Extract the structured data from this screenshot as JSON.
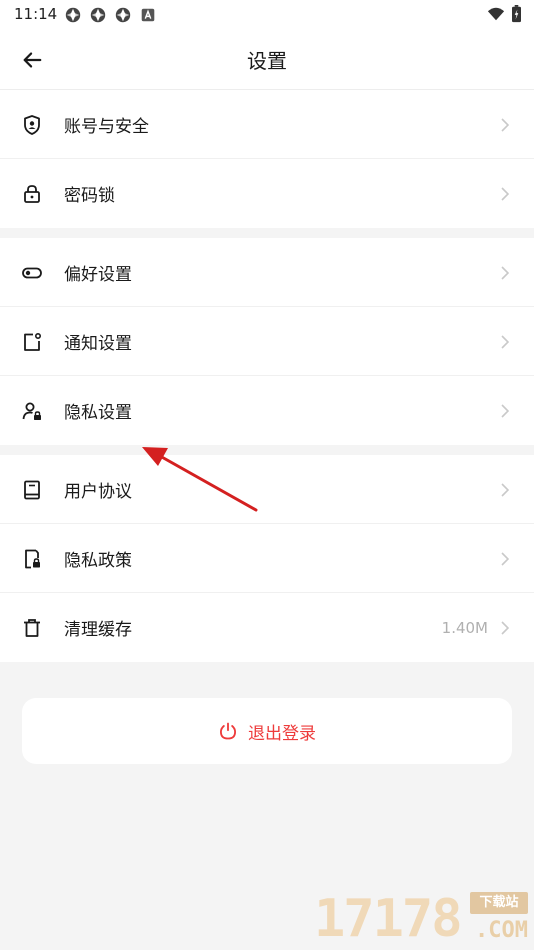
{
  "status_bar": {
    "time": "11:14",
    "notification_icons": [
      "app-notification-icon",
      "app-notification-icon",
      "app-notification-icon",
      "a-badge-icon"
    ],
    "right_icons": [
      "wifi-icon",
      "battery-icon"
    ]
  },
  "header": {
    "title": "设置",
    "back_icon": "arrow-left-icon"
  },
  "groups": [
    {
      "items": [
        {
          "label": "账号与安全",
          "icon": "shield-user-icon",
          "value": ""
        },
        {
          "label": "密码锁",
          "icon": "lock-icon",
          "value": ""
        }
      ]
    },
    {
      "items": [
        {
          "label": "偏好设置",
          "icon": "toggle-icon",
          "value": ""
        },
        {
          "label": "通知设置",
          "icon": "notification-icon",
          "value": ""
        },
        {
          "label": "隐私设置",
          "icon": "user-lock-icon",
          "value": ""
        }
      ]
    },
    {
      "items": [
        {
          "label": "用户协议",
          "icon": "book-icon",
          "value": ""
        },
        {
          "label": "隐私政策",
          "icon": "document-lock-icon",
          "value": ""
        },
        {
          "label": "清理缓存",
          "icon": "trash-icon",
          "value": "1.40M"
        }
      ]
    }
  ],
  "logout": {
    "label": "退出登录",
    "icon": "power-icon"
  },
  "watermark": {
    "digits": "17178",
    "badge": "下载站",
    "domain": ".COM"
  },
  "colors": {
    "accent_red": "#ee3b3b",
    "background": "#f4f4f4",
    "annotation_arrow": "#d42020",
    "watermark": "#e2c7a1"
  }
}
